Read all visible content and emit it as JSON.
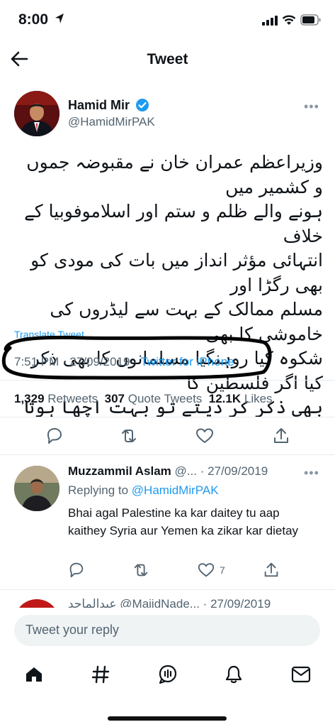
{
  "status_bar": {
    "time": "8:00"
  },
  "header": {
    "title": "Tweet"
  },
  "tweet": {
    "author_name": "Hamid Mir",
    "author_handle": "@HamidMirPAK",
    "text_lines": [
      "وزیراعظم عمران خان نے مقبوضہ جموں و کشمیر میں",
      "ہونے والے ظلم و ستم اور اسلاموفوبیا کے خلاف",
      "انتہائی مؤثر انداز میں بات کی مودی کو بھی رگڑا اور",
      "مسلم ممالک کے بہت سے لیڈروں کی خاموشی کا بھی",
      "شکوہ کیا روہنگیا مسلمانوں کا بھی ذکر کیا اگر فلسطین کا",
      "بھی ذکر کر دیتے تو بہت اچھا ہوتا"
    ],
    "translate_label": "Translate Tweet",
    "time": "7:51 PM",
    "date": "27/09/2019",
    "source": "Twitter for iPhone",
    "sep": " · ",
    "retweets_count": "1,329",
    "retweets_label": "Retweets",
    "quotes_count": "307",
    "quotes_label": "Quote Tweets",
    "likes_count": "12.1K",
    "likes_label": "Likes"
  },
  "reply": {
    "author_name": "Muzzammil Aslam",
    "author_handle_trunc": "@...",
    "date": "· 27/09/2019",
    "replying_prefix": "Replying to",
    "replying_handle": "@HamidMirPAK",
    "text": "Bhai agal Palestine ka kar daitey tu aap kaithey Syria aur Yemen ka zikar kar dietay",
    "like_count": "7"
  },
  "next_reply_peek": "عبدالماجد @MajidNade... · 27/09/2019",
  "composer": {
    "placeholder": "Tweet your reply"
  },
  "colors": {
    "accent": "#1d9bf0",
    "text": "#0f1419",
    "muted": "#536471"
  }
}
